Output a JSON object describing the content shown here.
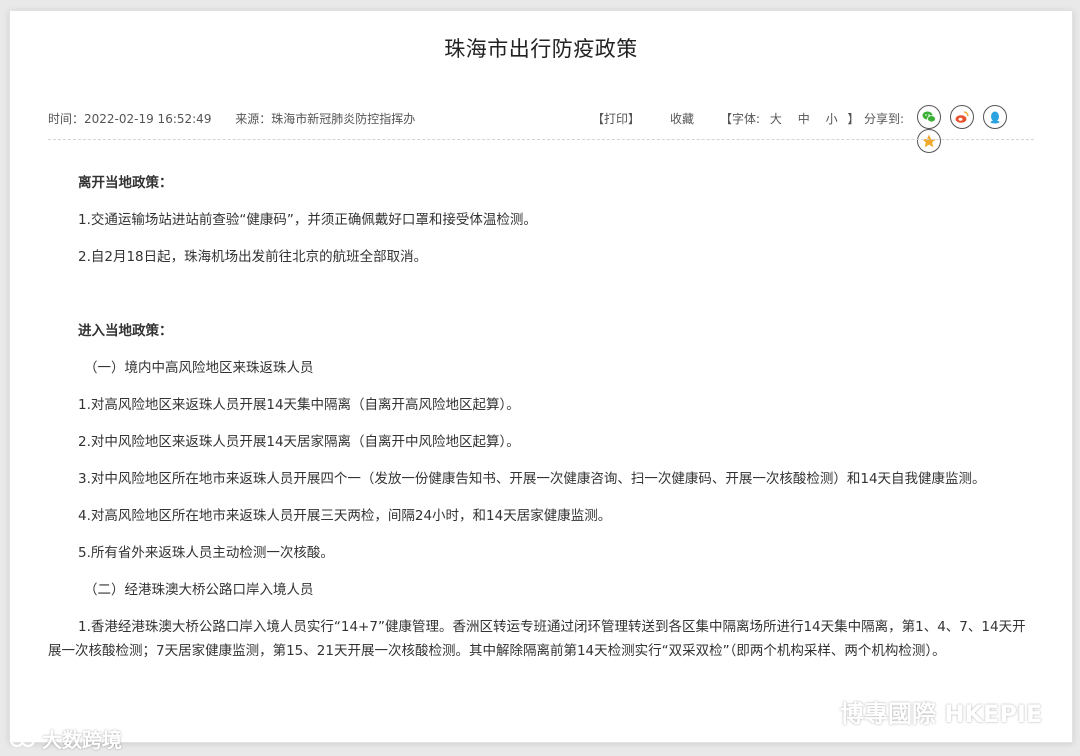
{
  "article": {
    "title": "珠海市出行防疫政策",
    "time": "时间：2022-02-19 16:52:49",
    "source": "来源：珠海市新冠肺炎防控指挥办"
  },
  "toolbar": {
    "print": "【打印】",
    "favorite": "收藏",
    "font_prefix": "【字体:",
    "font_large": "大",
    "font_medium": "中",
    "font_small": "小",
    "font_suffix": "】",
    "share_label": "分享到:",
    "share_icons": [
      "wechat-icon",
      "weibo-icon",
      "qq-icon",
      "qzone-icon"
    ],
    "share_colors": {
      "wechat": "#3cb034",
      "weibo": "#e6522c",
      "qq": "#2ba3e0",
      "qzone": "#f0a92b"
    }
  },
  "content": {
    "leave_heading": "离开当地政策：",
    "leave_1": "1.交通运输场站进站前查验“健康码”，并须正确佩戴好口罩和接受体温检测。",
    "leave_2": "2.自2月18日起，珠海机场出发前往北京的航班全部取消。",
    "enter_heading": "进入当地政策：",
    "section_1": "（一）境内中高风险地区来珠返珠人员",
    "s1_1": "1.对高风险地区来返珠人员开展14天集中隔离（自离开高风险地区起算）。",
    "s1_2": "2.对中风险地区来返珠人员开展14天居家隔离（自离开中风险地区起算）。",
    "s1_3": "3.对中风险地区所在地市来返珠人员开展四个一（发放一份健康告知书、开展一次健康咨询、扫一次健康码、开展一次核酸检测）和14天自我健康监测。",
    "s1_4": "4.对高风险地区所在地市来返珠人员开展三天两检，间隔24小时，和14天居家健康监测。",
    "s1_5": "5.所有省外来返珠人员主动检测一次核酸。",
    "section_2": "（二）经港珠澳大桥公路口岸入境人员",
    "s2_1": "1.香港经港珠澳大桥公路口岸入境人员实行“14+7”健康管理。香洲区转运专班通过闭环管理转送到各区集中隔离场所进行14天集中隔离，第1、4、7、14天开展一次核酸检测；7天居家健康监测，第15、21天开展一次核酸检测。其中解除隔离前第14天检测实行“双采双检”（即两个机构采样、两个机构检测）。"
  },
  "watermarks": {
    "left": "大数跨境",
    "right": "博專國際 HKEPIE"
  }
}
